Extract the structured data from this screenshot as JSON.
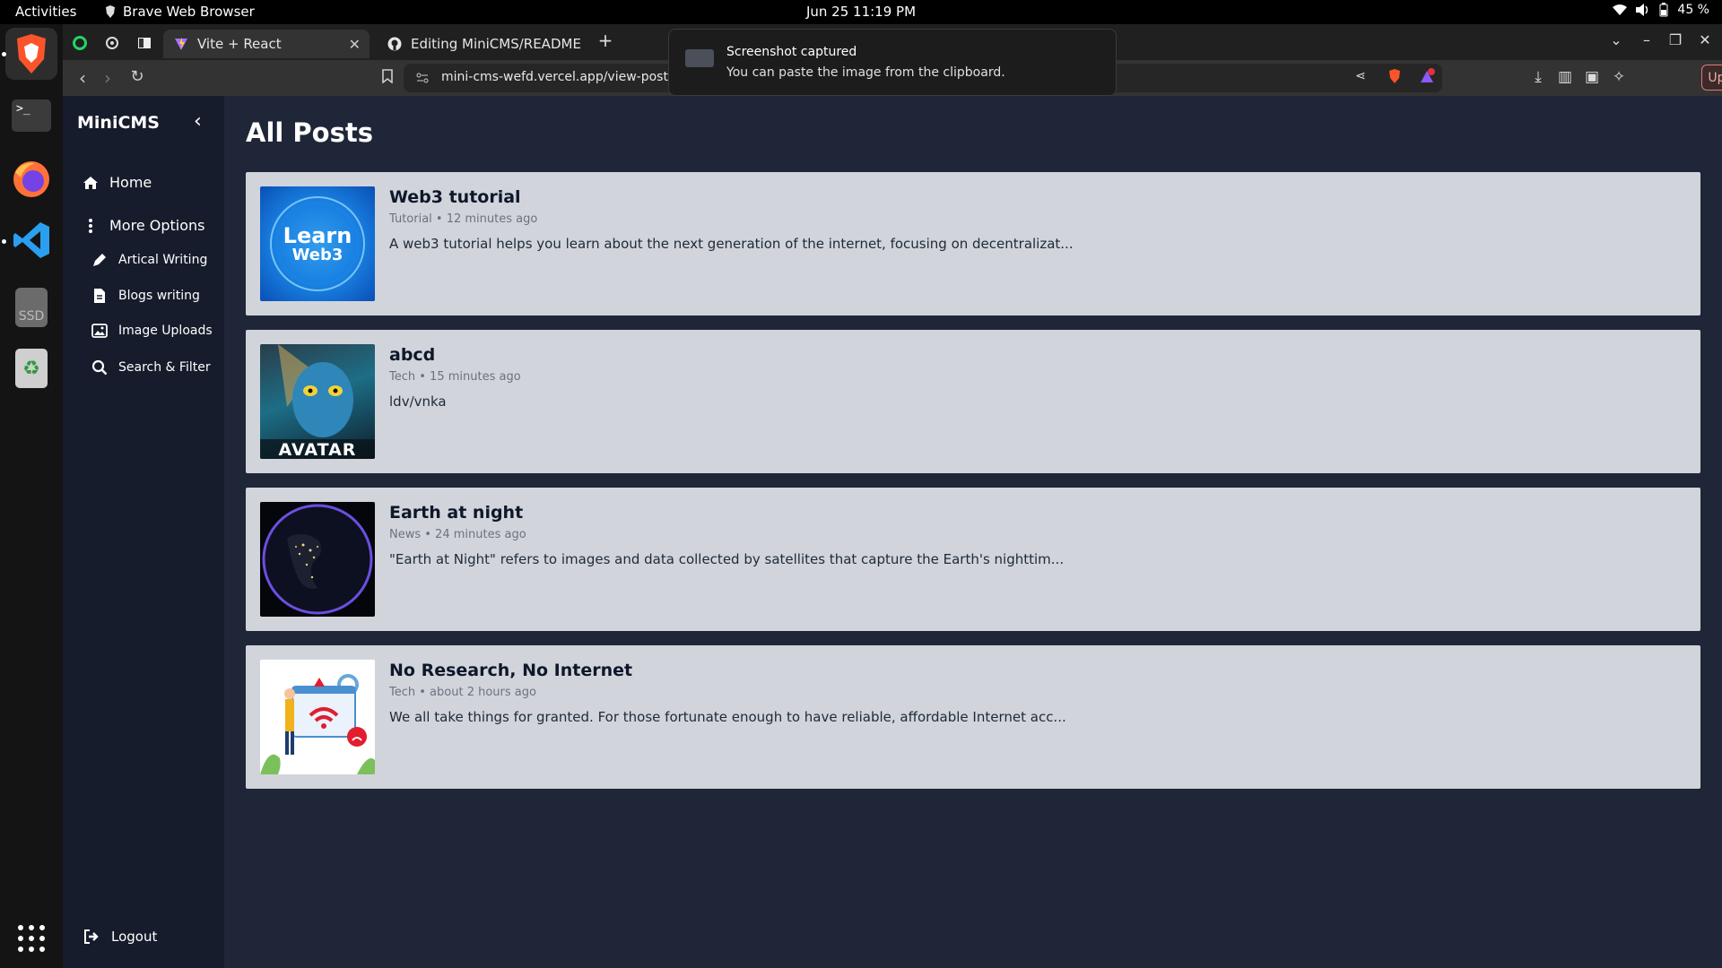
{
  "system": {
    "activities": "Activities",
    "app_name": "Brave Web Browser",
    "clock": "Jun 25  11:19 PM",
    "battery": "45 %"
  },
  "browser": {
    "tabs": [
      {
        "label": "Vite + React",
        "active": true
      },
      {
        "label": "Editing MiniCMS/README.m",
        "active": false
      }
    ],
    "url": "mini-cms-wefd.vercel.app/view-posts",
    "update_label": "Update"
  },
  "notification": {
    "title": "Screenshot captured",
    "body": "You can paste the image from the clipboard."
  },
  "sidebar": {
    "brand": "MiniCMS",
    "home": "Home",
    "more_options": "More Options",
    "sub_items": [
      {
        "label": "Artical Writing",
        "icon": "pen-icon"
      },
      {
        "label": "Blogs writing",
        "icon": "document-icon"
      },
      {
        "label": "Image Uploads",
        "icon": "image-icon"
      },
      {
        "label": "Search & Filter",
        "icon": "search-icon"
      }
    ],
    "logout": "Logout"
  },
  "main": {
    "title": "All Posts",
    "posts": [
      {
        "title": "Web3 tutorial",
        "meta": "Tutorial • 12 minutes ago",
        "excerpt": "A web3 tutorial helps you learn about the next generation of the internet, focusing on decentralizat...",
        "thumb_text_1": "Learn",
        "thumb_text_2": "Web3"
      },
      {
        "title": "abcd",
        "meta": "Tech • 15 minutes ago",
        "excerpt": "ldv/vnka",
        "thumb_text_1": "AVATAR"
      },
      {
        "title": "Earth at night",
        "meta": "News • 24 minutes ago",
        "excerpt": "\"Earth at Night\" refers to images and data collected by satellites that capture the Earth's nighttim..."
      },
      {
        "title": "No Research, No Internet",
        "meta": "Tech • about 2 hours ago",
        "excerpt": "We all take things for granted. For those fortunate enough to have reliable, affordable Internet acc..."
      }
    ]
  }
}
